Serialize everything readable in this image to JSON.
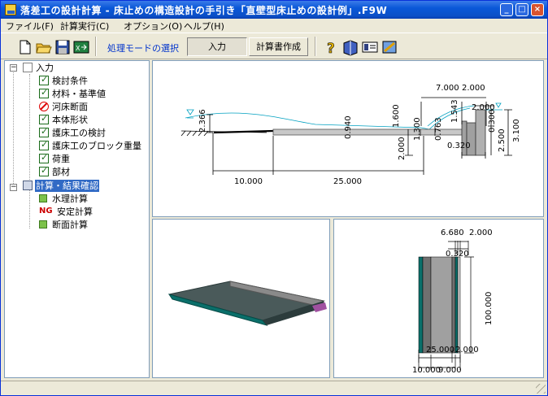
{
  "window": {
    "title": "落差工の設計計算 - 床止めの構造設計の手引き「直壁型床止めの設計例」.F9W",
    "minimize_glyph": "_",
    "maximize_glyph": "□",
    "close_glyph": "×"
  },
  "menu": [
    {
      "label": "ファイル(F)"
    },
    {
      "label": "計算実行(C)"
    },
    {
      "label": "オプション(O)"
    },
    {
      "label": "ヘルプ(H)"
    }
  ],
  "toolbar": {
    "mode_label": "処理モードの選択",
    "input_mode": "入力",
    "report_mode": "計算書作成"
  },
  "tree": {
    "input_root": "入力",
    "items": [
      {
        "label": "検討条件",
        "icon": "check"
      },
      {
        "label": "材料・基準値",
        "icon": "check"
      },
      {
        "label": "河床断面",
        "icon": "prohibited"
      },
      {
        "label": "本体形状",
        "icon": "check"
      },
      {
        "label": "護床工の検討",
        "icon": "check"
      },
      {
        "label": "護床工のブロック重量",
        "icon": "check"
      },
      {
        "label": "荷重",
        "icon": "check"
      },
      {
        "label": "部材",
        "icon": "check"
      }
    ],
    "calc_root": "計算・結果確認",
    "calc_items": [
      {
        "label": "水理計算",
        "badge": ""
      },
      {
        "label": "安定計算",
        "badge": "NG"
      },
      {
        "label": "断面計算",
        "badge": ""
      }
    ]
  },
  "section_view": {
    "dims": {
      "top_7": "7.000",
      "top_2a": "2.000",
      "top_2b": "2.000",
      "h_1543": "1.543",
      "h_2366": "2.366",
      "h_0940": "0.940",
      "h_1600": "1.600",
      "h_1300": "1.300",
      "h_0763": "0.763",
      "h_0300": "0.300",
      "h_3100": "3.100",
      "h_2500": "2.500",
      "h_2000": "2.000",
      "w_0320": "0.320",
      "len_10": "10.000",
      "len_25": "25.000"
    }
  },
  "plan_view": {
    "dims": {
      "top_6680": "6.680",
      "top_2000": "2.000",
      "top_0320": "0.320",
      "height_100": "100.000",
      "bot_25": "25.000",
      "bot_2": "2.000",
      "bot_10": "10.000",
      "bot_9": "9.000"
    }
  },
  "colors": {
    "titlebar": "#0a58d8",
    "water": "#00b0c8",
    "concrete": "#a0a0a0",
    "apron": "#0a6f6a"
  }
}
